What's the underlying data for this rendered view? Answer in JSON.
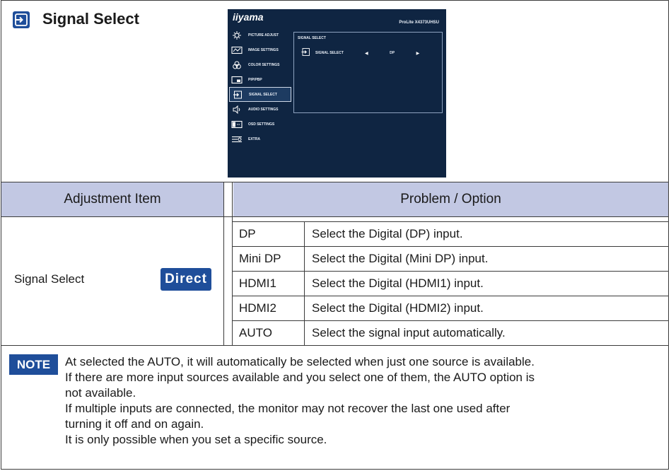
{
  "title": "Signal Select",
  "osd": {
    "brand": "iiyama",
    "model": "ProLite X4373UHSU",
    "menu": [
      {
        "label": "PICTURE ADJUST",
        "icon": "picture-adjust-icon"
      },
      {
        "label": "IMAGE SETTINGS",
        "icon": "image-settings-icon"
      },
      {
        "label": "COLOR SETTINGS",
        "icon": "color-settings-icon"
      },
      {
        "label": "PIP/PBP",
        "icon": "pip-pbp-icon"
      },
      {
        "label": "SIGNAL SELECT",
        "icon": "signal-select-icon",
        "selected": true
      },
      {
        "label": "AUDIO SETTINGS",
        "icon": "audio-settings-icon"
      },
      {
        "label": "OSD SETTINGS",
        "icon": "osd-settings-icon"
      },
      {
        "label": "EXTRA",
        "icon": "extra-icon"
      }
    ],
    "panel_title": "SIGNAL SELECT",
    "row_label": "SIGNAL SELECT",
    "row_value": "DP",
    "left_arrow": "◀",
    "right_arrow": "▶"
  },
  "table": {
    "headers": [
      "Adjustment Item",
      "Problem / Option"
    ],
    "item": "Signal Select",
    "badge": "Direct",
    "rows": [
      {
        "option": "DP",
        "description": "Select the Digital (DP) input."
      },
      {
        "option": "Mini DP",
        "description": "Select the Digital (Mini DP) input."
      },
      {
        "option": "HDMI1",
        "description": "Select the Digital (HDMI1) input."
      },
      {
        "option": "HDMI2",
        "description": "Select the Digital (HDMI2) input."
      },
      {
        "option": "AUTO",
        "description": "Select the signal input automatically."
      }
    ]
  },
  "note": {
    "badge": "NOTE",
    "lines": [
      "At selected the AUTO, it will automatically be selected when just one source is available.",
      "If there are more input sources available and you select one of them, the AUTO option is",
      "not available.",
      "If multiple inputs are connected, the monitor may not recover the last one used after",
      "turning it off and on again.",
      "It is only possible when you set a specific source."
    ]
  },
  "colors": {
    "accent_blue": "#1f4e9a",
    "header_bg": "#c2c8e3",
    "osd_bg": "#0f2542"
  }
}
